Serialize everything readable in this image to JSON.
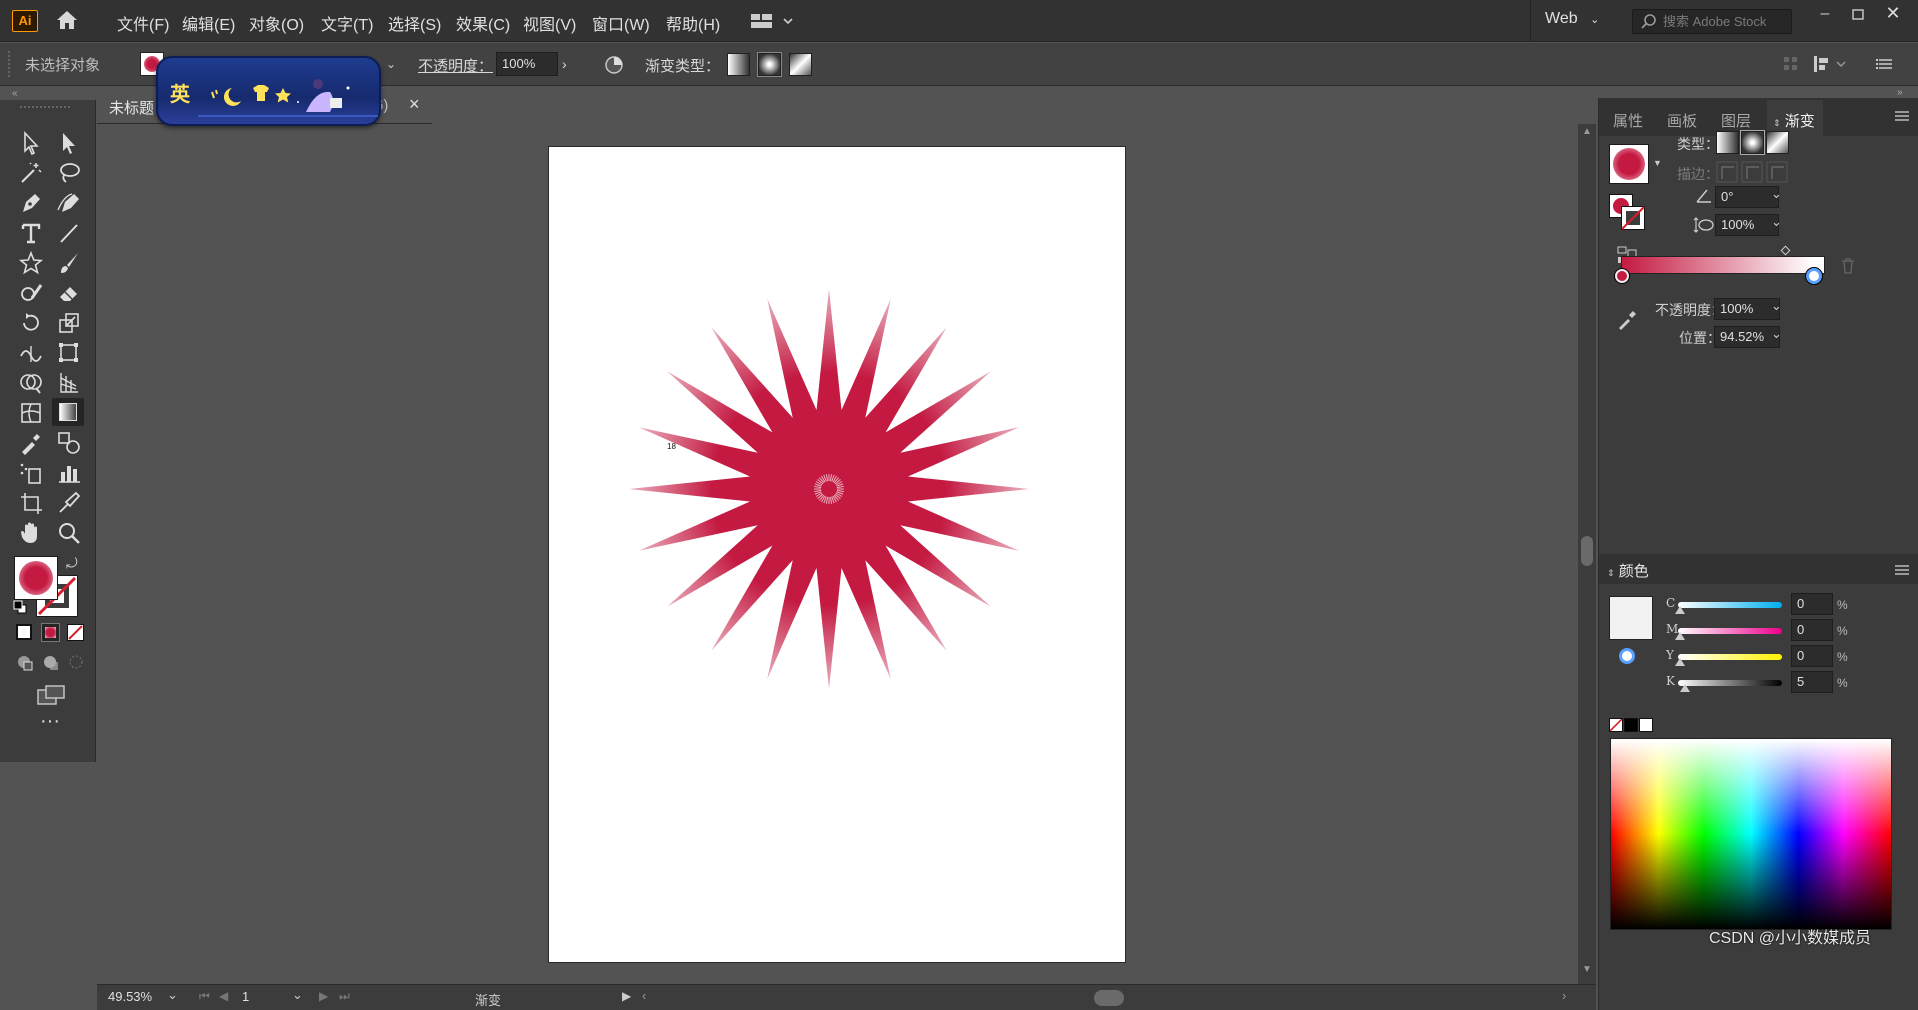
{
  "app": {
    "logo": "Ai"
  },
  "menu": [
    "文件(F)",
    "编辑(E)",
    "对象(O)",
    "文字(T)",
    "选择(S)",
    "效果(C)",
    "视图(V)",
    "窗口(W)",
    "帮助(H)"
  ],
  "workspace": "Web",
  "search": {
    "placeholder": "搜索 Adobe Stock"
  },
  "controlbar": {
    "selection": "未选择对象",
    "opacity_label": "不透明度：",
    "opacity_value": "100%",
    "gradient_type_label": "渐变类型："
  },
  "ime": {
    "label": "英"
  },
  "doc": {
    "tab_title": "未标题",
    "tab_suffix": "6)",
    "close": "×"
  },
  "artboard": {
    "annotation": "18"
  },
  "status": {
    "zoom": "49.53%",
    "page": "1",
    "tool_name": "渐变"
  },
  "panel_tabs": [
    "属性",
    "画板",
    "图层",
    "渐变"
  ],
  "gradient": {
    "type_label": "类型：",
    "stroke_label": "描边：",
    "angle": "0°",
    "aspect": "100%",
    "opacity_label": "不透明度：",
    "opacity_value": "100%",
    "location_label": "位置：",
    "location_value": "94.52%",
    "start_color": "#c41a42",
    "end_color": "#ffffff"
  },
  "color_panel": {
    "title": "颜色",
    "channels": [
      {
        "name": "C",
        "value": "0",
        "pct": "%"
      },
      {
        "name": "M",
        "value": "0",
        "pct": "%"
      },
      {
        "name": "Y",
        "value": "0",
        "pct": "%"
      },
      {
        "name": "K",
        "value": "5",
        "pct": "%"
      }
    ]
  },
  "watermark": "CSDN @小小数媒成员",
  "colors": {
    "accent": "#c41a42",
    "ui_dark": "#323232",
    "canvas": "#535353"
  }
}
